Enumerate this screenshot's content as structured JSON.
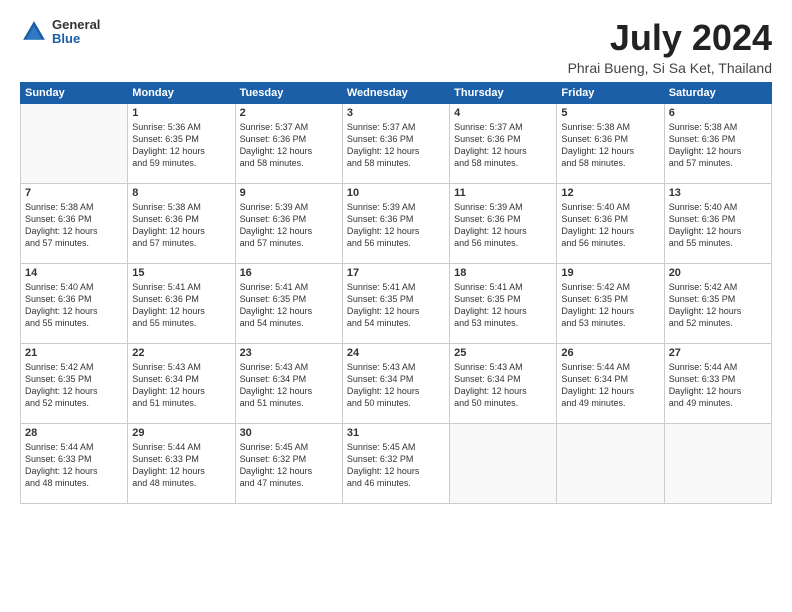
{
  "header": {
    "logo_general": "General",
    "logo_blue": "Blue",
    "title": "July 2024",
    "subtitle": "Phrai Bueng, Si Sa Ket, Thailand"
  },
  "weekdays": [
    "Sunday",
    "Monday",
    "Tuesday",
    "Wednesday",
    "Thursday",
    "Friday",
    "Saturday"
  ],
  "weeks": [
    [
      {
        "day": "",
        "info": ""
      },
      {
        "day": "1",
        "info": "Sunrise: 5:36 AM\nSunset: 6:35 PM\nDaylight: 12 hours\nand 59 minutes."
      },
      {
        "day": "2",
        "info": "Sunrise: 5:37 AM\nSunset: 6:36 PM\nDaylight: 12 hours\nand 58 minutes."
      },
      {
        "day": "3",
        "info": "Sunrise: 5:37 AM\nSunset: 6:36 PM\nDaylight: 12 hours\nand 58 minutes."
      },
      {
        "day": "4",
        "info": "Sunrise: 5:37 AM\nSunset: 6:36 PM\nDaylight: 12 hours\nand 58 minutes."
      },
      {
        "day": "5",
        "info": "Sunrise: 5:38 AM\nSunset: 6:36 PM\nDaylight: 12 hours\nand 58 minutes."
      },
      {
        "day": "6",
        "info": "Sunrise: 5:38 AM\nSunset: 6:36 PM\nDaylight: 12 hours\nand 57 minutes."
      }
    ],
    [
      {
        "day": "7",
        "info": "Sunrise: 5:38 AM\nSunset: 6:36 PM\nDaylight: 12 hours\nand 57 minutes."
      },
      {
        "day": "8",
        "info": "Sunrise: 5:38 AM\nSunset: 6:36 PM\nDaylight: 12 hours\nand 57 minutes."
      },
      {
        "day": "9",
        "info": "Sunrise: 5:39 AM\nSunset: 6:36 PM\nDaylight: 12 hours\nand 57 minutes."
      },
      {
        "day": "10",
        "info": "Sunrise: 5:39 AM\nSunset: 6:36 PM\nDaylight: 12 hours\nand 56 minutes."
      },
      {
        "day": "11",
        "info": "Sunrise: 5:39 AM\nSunset: 6:36 PM\nDaylight: 12 hours\nand 56 minutes."
      },
      {
        "day": "12",
        "info": "Sunrise: 5:40 AM\nSunset: 6:36 PM\nDaylight: 12 hours\nand 56 minutes."
      },
      {
        "day": "13",
        "info": "Sunrise: 5:40 AM\nSunset: 6:36 PM\nDaylight: 12 hours\nand 55 minutes."
      }
    ],
    [
      {
        "day": "14",
        "info": "Sunrise: 5:40 AM\nSunset: 6:36 PM\nDaylight: 12 hours\nand 55 minutes."
      },
      {
        "day": "15",
        "info": "Sunrise: 5:41 AM\nSunset: 6:36 PM\nDaylight: 12 hours\nand 55 minutes."
      },
      {
        "day": "16",
        "info": "Sunrise: 5:41 AM\nSunset: 6:35 PM\nDaylight: 12 hours\nand 54 minutes."
      },
      {
        "day": "17",
        "info": "Sunrise: 5:41 AM\nSunset: 6:35 PM\nDaylight: 12 hours\nand 54 minutes."
      },
      {
        "day": "18",
        "info": "Sunrise: 5:41 AM\nSunset: 6:35 PM\nDaylight: 12 hours\nand 53 minutes."
      },
      {
        "day": "19",
        "info": "Sunrise: 5:42 AM\nSunset: 6:35 PM\nDaylight: 12 hours\nand 53 minutes."
      },
      {
        "day": "20",
        "info": "Sunrise: 5:42 AM\nSunset: 6:35 PM\nDaylight: 12 hours\nand 52 minutes."
      }
    ],
    [
      {
        "day": "21",
        "info": "Sunrise: 5:42 AM\nSunset: 6:35 PM\nDaylight: 12 hours\nand 52 minutes."
      },
      {
        "day": "22",
        "info": "Sunrise: 5:43 AM\nSunset: 6:34 PM\nDaylight: 12 hours\nand 51 minutes."
      },
      {
        "day": "23",
        "info": "Sunrise: 5:43 AM\nSunset: 6:34 PM\nDaylight: 12 hours\nand 51 minutes."
      },
      {
        "day": "24",
        "info": "Sunrise: 5:43 AM\nSunset: 6:34 PM\nDaylight: 12 hours\nand 50 minutes."
      },
      {
        "day": "25",
        "info": "Sunrise: 5:43 AM\nSunset: 6:34 PM\nDaylight: 12 hours\nand 50 minutes."
      },
      {
        "day": "26",
        "info": "Sunrise: 5:44 AM\nSunset: 6:34 PM\nDaylight: 12 hours\nand 49 minutes."
      },
      {
        "day": "27",
        "info": "Sunrise: 5:44 AM\nSunset: 6:33 PM\nDaylight: 12 hours\nand 49 minutes."
      }
    ],
    [
      {
        "day": "28",
        "info": "Sunrise: 5:44 AM\nSunset: 6:33 PM\nDaylight: 12 hours\nand 48 minutes."
      },
      {
        "day": "29",
        "info": "Sunrise: 5:44 AM\nSunset: 6:33 PM\nDaylight: 12 hours\nand 48 minutes."
      },
      {
        "day": "30",
        "info": "Sunrise: 5:45 AM\nSunset: 6:32 PM\nDaylight: 12 hours\nand 47 minutes."
      },
      {
        "day": "31",
        "info": "Sunrise: 5:45 AM\nSunset: 6:32 PM\nDaylight: 12 hours\nand 46 minutes."
      },
      {
        "day": "",
        "info": ""
      },
      {
        "day": "",
        "info": ""
      },
      {
        "day": "",
        "info": ""
      }
    ]
  ]
}
